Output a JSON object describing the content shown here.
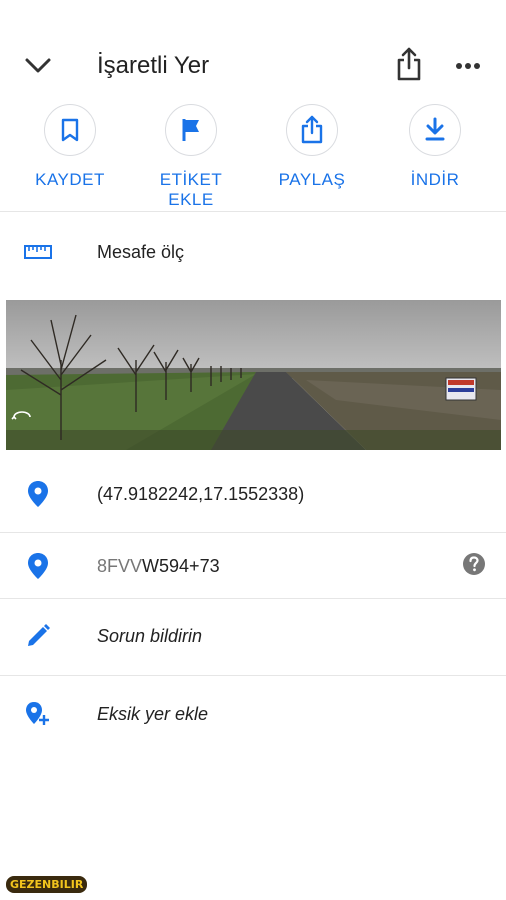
{
  "header": {
    "title": "İşaretli Yer"
  },
  "actions": [
    {
      "label": "KAYDET",
      "icon": "bookmark-icon"
    },
    {
      "label": "ETİKET\nEKLE",
      "icon": "flag-icon"
    },
    {
      "label": "PAYLAŞ",
      "icon": "share-icon"
    },
    {
      "label": "İNDİR",
      "icon": "download-icon"
    }
  ],
  "measure": {
    "label": "Mesafe ölç",
    "icon": "ruler-icon"
  },
  "coords": {
    "value": "(47.9182242,17.1552338)",
    "icon": "location-pin-icon"
  },
  "plus_code": {
    "prefix": "8FVV",
    "code": "W594+73",
    "icon": "location-pin-icon"
  },
  "report": {
    "label": "Sorun bildirin",
    "icon": "pencil-icon"
  },
  "add_place": {
    "label": "Eksik yer ekle",
    "icon": "add-location-icon"
  },
  "watermark": {
    "text": "GEZENBILIR"
  },
  "colors": {
    "accent": "#1a73e8",
    "text": "#222222",
    "divider": "#e6e6e6"
  }
}
